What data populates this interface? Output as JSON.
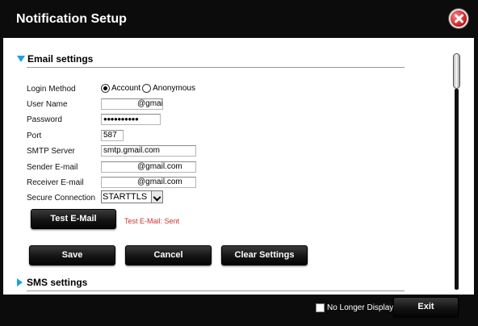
{
  "dialog": {
    "title": "Notification Setup"
  },
  "email_section": {
    "heading": "Email settings",
    "login_method": {
      "label": "Login Method",
      "options": [
        "Account",
        "Anonymous"
      ],
      "selected": "Account"
    },
    "user_name": {
      "label": "User Name",
      "value": "@gmai"
    },
    "password": {
      "label": "Password",
      "value": "●●●●●●●●●●"
    },
    "port": {
      "label": "Port",
      "value": "587"
    },
    "smtp_server": {
      "label": "SMTP Server",
      "value": "smtp.gmail.com"
    },
    "sender_email": {
      "label": "Sender E-mail",
      "value": "@gmail.com"
    },
    "receiver_email": {
      "label": "Receiver E-mail",
      "value": "@gmail.com"
    },
    "secure_connection": {
      "label": "Secure Connection",
      "value": "STARTTLS"
    },
    "test_button": "Test E-Mail",
    "test_status": "Test E-Mail: Sent",
    "save_button": "Save",
    "cancel_button": "Cancel",
    "clear_button": "Clear Settings"
  },
  "sms_section": {
    "heading": "SMS settings"
  },
  "footer": {
    "no_longer_display": "No Longer Display",
    "exit_button": "Exit"
  },
  "colors": {
    "accent_triangle": "#1aa0e8",
    "status_red": "#d0312d",
    "close_red": "#c71818"
  }
}
